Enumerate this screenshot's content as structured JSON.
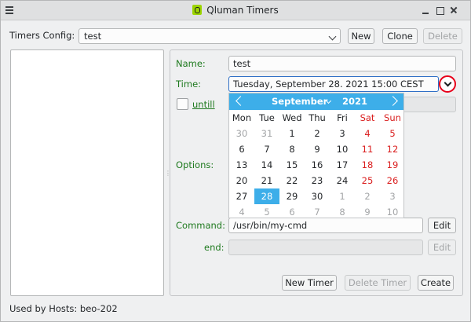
{
  "window": {
    "title": "Qluman Timers"
  },
  "config": {
    "label": "Timers Config:",
    "value": "test",
    "new_label": "New",
    "clone_label": "Clone",
    "delete_label": "Delete"
  },
  "form": {
    "name_label": "Name:",
    "name_value": "test",
    "time_label": "Time:",
    "time_value": "Tuesday, September 28. 2021 15:00 CEST",
    "until_label": "untill",
    "options_label": "Options:",
    "command_label": "Command:",
    "command_value": "/usr/bin/my-cmd",
    "command_edit": "Edit",
    "end_label": "end:",
    "end_value": "",
    "end_edit": "Edit"
  },
  "actions": {
    "new_timer": "New Timer",
    "delete_timer": "Delete Timer",
    "create": "Create"
  },
  "footer": {
    "hosts": "Used by Hosts: beo-202"
  },
  "calendar": {
    "month": "September",
    "year": "2021",
    "weekdays": [
      "Mon",
      "Tue",
      "Wed",
      "Thu",
      "Fri",
      "Sat",
      "Sun"
    ],
    "weeks": [
      [
        "30",
        "31",
        "1",
        "2",
        "3",
        "4",
        "5"
      ],
      [
        "6",
        "7",
        "8",
        "9",
        "10",
        "11",
        "12"
      ],
      [
        "13",
        "14",
        "15",
        "16",
        "17",
        "18",
        "19"
      ],
      [
        "20",
        "21",
        "22",
        "23",
        "24",
        "25",
        "26"
      ],
      [
        "27",
        "28",
        "29",
        "30",
        "1",
        "2",
        "3"
      ],
      [
        "4",
        "5",
        "6",
        "7",
        "8",
        "9",
        "10"
      ]
    ],
    "selected": "28"
  },
  "colors": {
    "accent": "#3daee9",
    "weekend": "#da1f1f",
    "label_green": "#1f7a1f",
    "highlight_ring": "#e8001a"
  }
}
